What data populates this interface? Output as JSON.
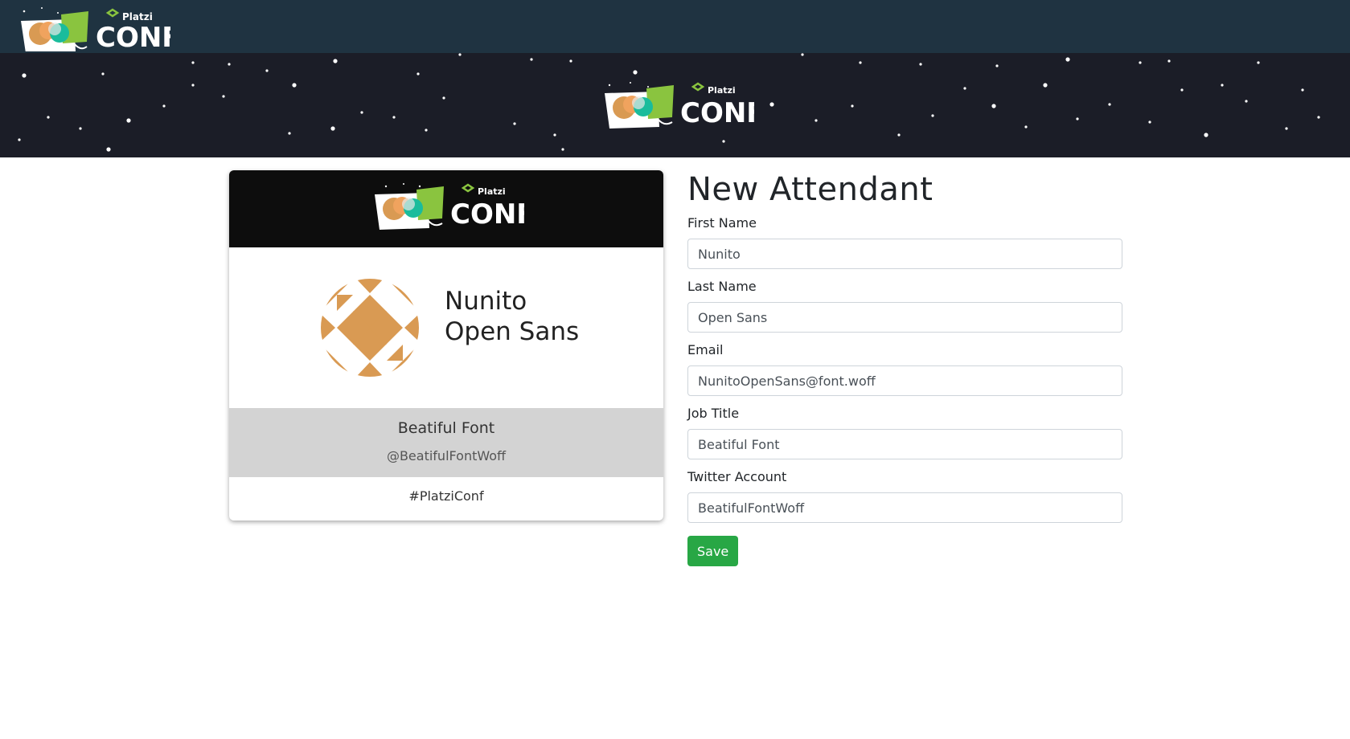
{
  "brand": {
    "platzi_label": "Platzi",
    "conf_label": "CONF"
  },
  "badge": {
    "first_name": "Nunito",
    "last_name": "Open Sans",
    "job_title": "Beatiful Font",
    "twitter": "@BeatifulFontWoff",
    "hashtag": "#PlatziConf",
    "avatar_color": "#d99a53"
  },
  "form": {
    "title": "New Attendant",
    "fields": [
      {
        "label": "First Name",
        "value": "Nunito"
      },
      {
        "label": "Last Name",
        "value": "Open Sans"
      },
      {
        "label": "Email",
        "value": "NunitoOpenSans@font.woff"
      },
      {
        "label": "Job Title",
        "value": "Beatiful Font"
      },
      {
        "label": "Twitter Account",
        "value": "BeatifulFontWoff"
      }
    ],
    "save_label": "Save"
  },
  "colors": {
    "navbar": "#1f3341",
    "hero": "#1b1d27",
    "save_button": "#28a745",
    "logo_green": "#8ac43f"
  }
}
